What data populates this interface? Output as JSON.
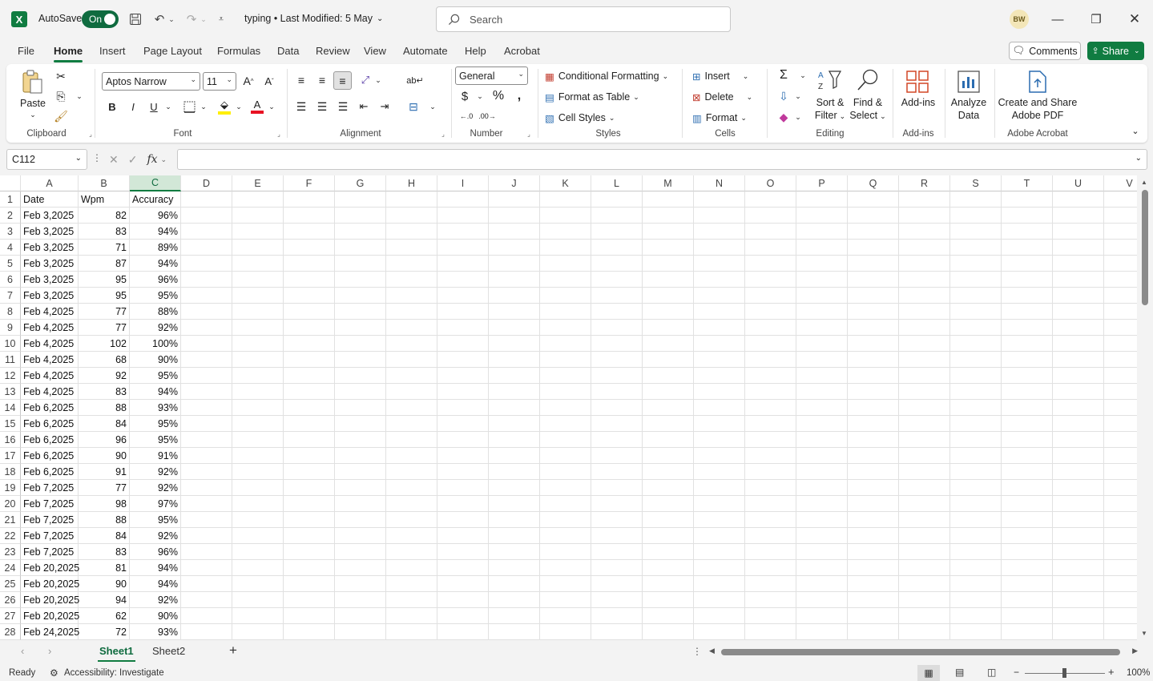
{
  "app": {
    "autosave_label": "AutoSave",
    "autosave_state": "On",
    "doc_title": "typing  •  Last Modified: 5 May",
    "search_placeholder": "Search",
    "user_initials": "BW"
  },
  "menu": {
    "tabs": [
      "File",
      "Home",
      "Insert",
      "Page Layout",
      "Formulas",
      "Data",
      "Review",
      "View",
      "Automate",
      "Help",
      "Acrobat"
    ],
    "active": "Home",
    "comments": "Comments",
    "share": "Share"
  },
  "ribbon": {
    "clipboard": {
      "label": "Clipboard",
      "paste": "Paste"
    },
    "font": {
      "label": "Font",
      "name": "Aptos Narrow",
      "size": "11"
    },
    "alignment": {
      "label": "Alignment"
    },
    "number": {
      "label": "Number",
      "format": "General"
    },
    "styles": {
      "label": "Styles",
      "conditional": "Conditional Formatting",
      "format_table": "Format as Table",
      "cell_styles": "Cell Styles"
    },
    "cells": {
      "label": "Cells",
      "insert": "Insert",
      "delete": "Delete",
      "format": "Format"
    },
    "editing": {
      "label": "Editing",
      "sort_1": "Sort &",
      "sort_2": "Filter",
      "find_1": "Find &",
      "find_2": "Select"
    },
    "addins": {
      "label": "Add-ins",
      "button": "Add-ins"
    },
    "analyze": {
      "line1": "Analyze",
      "line2": "Data"
    },
    "acrobat": {
      "label": "Adobe Acrobat",
      "line1": "Create and Share",
      "line2": "Adobe PDF"
    }
  },
  "formula_bar": {
    "name_box": "C112",
    "fx": "fx",
    "value": ""
  },
  "grid": {
    "columns": [
      "A",
      "B",
      "C",
      "D",
      "E",
      "F",
      "G",
      "H",
      "I",
      "J",
      "K",
      "L",
      "M",
      "N",
      "O",
      "P",
      "Q",
      "R",
      "S",
      "T",
      "U",
      "V"
    ],
    "selected_column": "C",
    "rows": [
      [
        "Date",
        "Wpm",
        "Accuracy"
      ],
      [
        "Feb 3,2025",
        "82",
        "96%"
      ],
      [
        "Feb 3,2025",
        "83",
        "94%"
      ],
      [
        "Feb 3,2025",
        "71",
        "89%"
      ],
      [
        "Feb 3,2025",
        "87",
        "94%"
      ],
      [
        "Feb 3,2025",
        "95",
        "96%"
      ],
      [
        "Feb 3,2025",
        "95",
        "95%"
      ],
      [
        "Feb 4,2025",
        "77",
        "88%"
      ],
      [
        "Feb 4,2025",
        "77",
        "92%"
      ],
      [
        "Feb 4,2025",
        "102",
        "100%"
      ],
      [
        "Feb 4,2025",
        "68",
        "90%"
      ],
      [
        "Feb 4,2025",
        "92",
        "95%"
      ],
      [
        "Feb 4,2025",
        "83",
        "94%"
      ],
      [
        "Feb 6,2025",
        "88",
        "93%"
      ],
      [
        "Feb 6,2025",
        "84",
        "95%"
      ],
      [
        "Feb 6,2025",
        "96",
        "95%"
      ],
      [
        "Feb 6,2025",
        "90",
        "91%"
      ],
      [
        "Feb 6,2025",
        "91",
        "92%"
      ],
      [
        "Feb 7,2025",
        "77",
        "92%"
      ],
      [
        "Feb 7,2025",
        "98",
        "97%"
      ],
      [
        "Feb 7,2025",
        "88",
        "95%"
      ],
      [
        "Feb 7,2025",
        "84",
        "92%"
      ],
      [
        "Feb 7,2025",
        "83",
        "96%"
      ],
      [
        "Feb 20,2025",
        "81",
        "94%"
      ],
      [
        "Feb 20,2025",
        "90",
        "94%"
      ],
      [
        "Feb 20,2025",
        "94",
        "92%"
      ],
      [
        "Feb 20,2025",
        "62",
        "90%"
      ],
      [
        "Feb 24,2025",
        "72",
        "93%"
      ]
    ]
  },
  "sheets": {
    "tabs": [
      "Sheet1",
      "Sheet2"
    ],
    "active": "Sheet1"
  },
  "status": {
    "ready": "Ready",
    "accessibility": "Accessibility: Investigate",
    "zoom": "100%"
  }
}
